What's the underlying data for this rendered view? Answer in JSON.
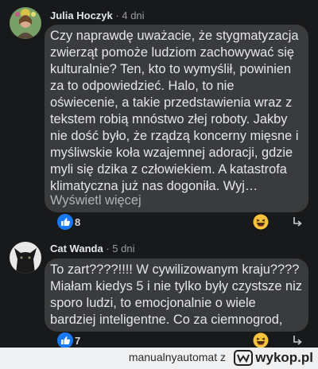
{
  "comments": [
    {
      "author": "Julia Hoczyk",
      "separator": "·",
      "time": "4 dni",
      "lines": [
        "Czy naprawdę uważacie, że stygmatyzacja",
        "zwierząt pomoże ludziom zachowywać się",
        "kulturalnie? Ten, kto to wymyślił, powinien",
        "za to odpowiedzieć. Halo, to nie",
        "oświecenie, a takie przedstawienia wraz z",
        "tekstem robią mnóstwo złej roboty. Jakby",
        "nie dość było, że rządzą koncerny mięsne i",
        "myśliwskie koła wzajemnej adoracji, gdzie",
        "myli się dzika z człowiekiem. A katastrofa",
        "klimatyczna już nas dogoniła. Wyj…"
      ],
      "see_more": "Wyświetl więcej",
      "like_count": "8",
      "reaction_icon": "haha-emoji-icon",
      "reply_icon": "reply-arrow-icon"
    },
    {
      "author": "Cat Wanda",
      "separator": "·",
      "time": "5 dni",
      "lines": [
        "To zart????!!!! W cywilizowanym kraju????",
        "Miałam kiedys 5 i nie tylko były czystsze niz",
        "sporo ludzi, to emocjonalnie  o wiele",
        "bardziej inteligentne. Co za ciemnogrod,"
      ],
      "like_count": "7",
      "reaction_icon": "haha-emoji-icon",
      "reply_icon": "reply-arrow-icon"
    }
  ],
  "footer": {
    "username": "manualnyautomat",
    "conjunction": "z",
    "site": "wykop.pl"
  },
  "colors": {
    "background": "#18191a",
    "bubble": "#3a3b3c",
    "like_blue": "#1877f2",
    "text": "#e4e6eb",
    "muted": "#9a9ca1"
  }
}
